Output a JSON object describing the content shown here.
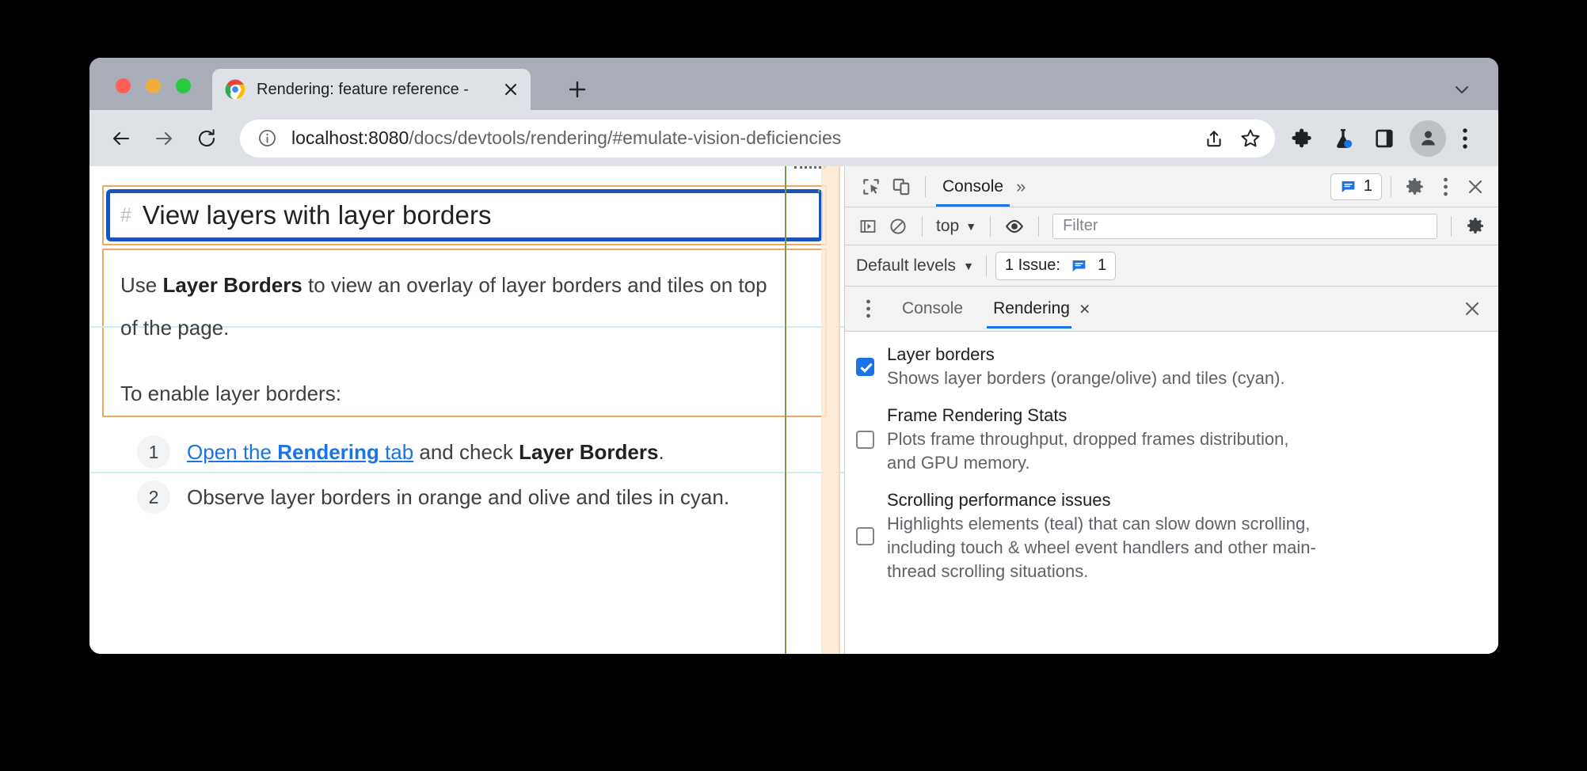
{
  "browser": {
    "tab": {
      "title": "Rendering: feature reference -",
      "favicon_name": "chrome-logo-icon",
      "close_label": "×"
    },
    "new_tab_label": "+",
    "tabstrip_chevron_name": "chevron-down-icon",
    "toolbar": {
      "back_label": "Back",
      "forward_label": "Forward",
      "reload_label": "Reload",
      "url_scheme_host": "localhost:8080",
      "url_path": "/docs/devtools/rendering/#emulate-vision-deficiencies",
      "url_full": "localhost:8080/docs/devtools/rendering/#emulate-vision-deficiencies",
      "share_label": "Share",
      "bookmark_label": "Bookmark",
      "extensions_label": "Extensions",
      "experiments_label": "Experiments",
      "sidepanel_label": "Side panel",
      "profile_label": "Profile",
      "menu_label": "Customize and control Google Chrome"
    }
  },
  "page": {
    "heading_hash": "#",
    "heading": "View layers with layer borders",
    "paragraph_1_pre": "Use ",
    "paragraph_1_bold": "Layer Borders",
    "paragraph_1_post": " to view an overlay of layer borders and tiles on top of the page.",
    "paragraph_2": "To enable layer borders:",
    "steps": [
      {
        "number": "1",
        "link_pre": "Open the ",
        "link_bold": "Rendering",
        "link_post": " tab",
        "mid": " and check ",
        "bold": "Layer Borders",
        "tail": "."
      },
      {
        "number": "2",
        "text": "Observe layer borders in orange and olive and tiles in cyan."
      }
    ],
    "overlay_colors": {
      "layer_border_orange": "#f0a862",
      "layer_border_olive": "#7d9a4a",
      "tile_cyan": "#c8eef2",
      "highlight_blue": "#1a53c0"
    }
  },
  "devtools": {
    "main_toolbar": {
      "inspect_label": "Inspect element",
      "device_toolbar_label": "Toggle device toolbar",
      "active_panel": "Console",
      "more_panels": "»",
      "issues_count": "1",
      "settings_label": "Settings",
      "more_options_label": "More options",
      "close_label": "Close DevTools"
    },
    "console_toolbar": {
      "sidebar_label": "Show console sidebar",
      "clear_label": "Clear console",
      "context": "top",
      "context_caret": "▼",
      "eye_label": "Create live expression",
      "filter_placeholder": "Filter",
      "settings_label": "Console settings"
    },
    "levels_toolbar": {
      "levels_label": "Default levels",
      "levels_caret": "▼",
      "issues_text": "1 Issue:",
      "issues_count": "1"
    },
    "drawer": {
      "menu_label": "More tools",
      "tabs": [
        {
          "label": "Console",
          "active": false,
          "closable": false
        },
        {
          "label": "Rendering",
          "active": true,
          "closable": true,
          "close_label": "×"
        }
      ],
      "close_label": "×"
    },
    "rendering": {
      "settings": [
        {
          "title": "Layer borders",
          "description": "Shows layer borders (orange/olive) and tiles (cyan).",
          "checked": true
        },
        {
          "title": "Frame Rendering Stats",
          "description": "Plots frame throughput, dropped frames distribution, and GPU memory.",
          "checked": false
        },
        {
          "title": "Scrolling performance issues",
          "description": "Highlights elements (teal) that can slow down scrolling, including touch & wheel event handlers and other main-thread scrolling situations.",
          "checked": false
        }
      ]
    }
  }
}
